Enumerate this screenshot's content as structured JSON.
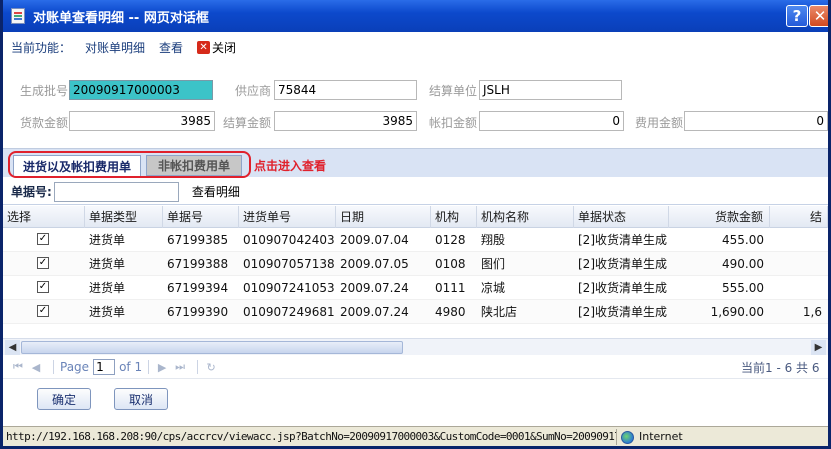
{
  "window": {
    "title": "对账单查看明细 -- 网页对话框",
    "help_label": "?",
    "close_label": "✕"
  },
  "funcbar": {
    "label": "当前功能：",
    "module": "对账单明细",
    "action": "查看",
    "close_label": "关闭"
  },
  "form": {
    "batch_label": "生成批号",
    "batch_value": "20090917000003",
    "supplier_label": "供应商",
    "supplier_value": "75844",
    "settle_unit_label": "结算单位",
    "settle_unit_value": "JSLH",
    "goods_amount_label": "货款金额",
    "goods_amount_value": "3985",
    "settle_amount_label": "结算金额",
    "settle_amount_value": "3985",
    "deduct_amount_label": "帐扣金额",
    "deduct_amount_value": "0",
    "fee_amount_label": "费用金额",
    "fee_amount_value": "0"
  },
  "tabs": {
    "active": "进货以及帐扣费用单",
    "inactive": "非帐扣费用单",
    "hint": "点击进入查看"
  },
  "search": {
    "label": "单据号:",
    "value": "",
    "button": "查看明细"
  },
  "grid": {
    "headers": [
      "选择",
      "单据类型",
      "单据号",
      "进货单号",
      "日期",
      "机构",
      "机构名称",
      "单据状态",
      "货款金额",
      "结"
    ],
    "rows": [
      {
        "checked": "✓",
        "type": "进货单",
        "doc_no": "67199385",
        "purchase_no": "010907042403",
        "date": "2009.07.04",
        "org": "0128",
        "org_name": "翔殷",
        "status": "[2]收货清单生成",
        "amount": "455.00",
        "extra": ""
      },
      {
        "checked": "✓",
        "type": "进货单",
        "doc_no": "67199388",
        "purchase_no": "010907057138",
        "date": "2009.07.05",
        "org": "0108",
        "org_name": "图们",
        "status": "[2]收货清单生成",
        "amount": "490.00",
        "extra": ""
      },
      {
        "checked": "✓",
        "type": "进货单",
        "doc_no": "67199394",
        "purchase_no": "010907241053",
        "date": "2009.07.24",
        "org": "0111",
        "org_name": "凉城",
        "status": "[2]收货清单生成",
        "amount": "555.00",
        "extra": ""
      },
      {
        "checked": "✓",
        "type": "进货单",
        "doc_no": "67199390",
        "purchase_no": "010907249681",
        "date": "2009.07.24",
        "org": "4980",
        "org_name": "陕北店",
        "status": "[2]收货清单生成",
        "amount": "1,690.00",
        "extra": "1,6"
      }
    ]
  },
  "pager": {
    "page_label": "Page",
    "page_value": "1",
    "of_label": "of 1",
    "summary": "当前1 - 6 共 6"
  },
  "buttons": {
    "ok": "确定",
    "cancel": "取消"
  },
  "statusbar": {
    "url": "http://192.168.168.208:90/cps/accrcv/viewacc.jsp?BatchNo=20090917000003&CustomCode=0001&SumNo=200909170000",
    "zone": "Internet"
  }
}
